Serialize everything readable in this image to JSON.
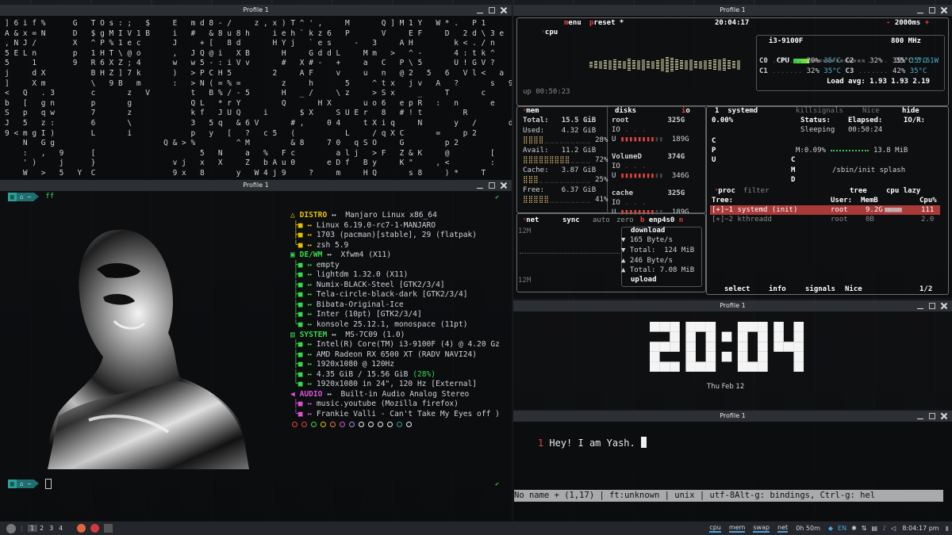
{
  "window_titles": {
    "top_left": "Profile 1",
    "mid_left": "Profile 1",
    "top_right": "Profile 1",
    "clock_pane": "Profile 1",
    "bottom_right": "Profile 1"
  },
  "matrix_lines": [
    "] 6 i f %      G   T O s : ;   $     E   m d 8 - /     z , x ) T ^ ' ,     M       Q ] M 1 Y   W * .   P 1",
    "A & x = N      D   $ g M I V 1 B     i   #   & 8 u 8 h     i e h ` k z 6   P       V     E F     D   2 d \\ 3 e",
    ", N J /        X   ^ P % 1 e c       J     + [   8 d       H Y j   ` e s     -   3     A H         k < . / n",
    "5 E L n        p   1 H T \\ @ o       ,   J Q @ i   X B       H     G d d L     M m   >   ^ -       4 : t k ^",
    "5     1        9   R 6 X Z ; 4       w   w 5 - : i V v       #   X # -   +     a   C   P \\ 5       U ! G V ?",
    "j     d X          B H Z ] 7 k       )   > P C H 5         2     A F     v     u   n   @ 2   5   6   V l <   a",
    "]     X m          \\   9 B   m       :   > N ( = % =         z     h       5     ^ t x   j v   A   ?       s   9",
    "<   Q   . 3        c       z   V         t   B % / - 5       H   _ /     \\ z     > S x     _     T       c",
    "b   [   g n        p       g             Q L   * r Y         Q       H X       u o 6   e p R   :   n       e",
    "S   p   q w        7       z             k f   J U Q     i       $ X     S U E r   8   # ! t         R",
    "J   5   z :        6       \\             3   5 q   & 6 V       # ,     0 4     t X i q     N       y   /       d",
    "9 < m g I )        L       i             p   y   [   ?   c 5   (           L     / q X C       =     p 2",
    "    N   G g                        Q & > %         ^ M         & 8     7 0   q S O     G         p 2",
    "    :   ,   9      [                       5   N     a   %   F c         a l j   > F   Z & K     @         [",
    "    ' )     j      }                 v j   x   X     Z   b A u 0       e D f   B y     K \"     , <         :",
    "    W   >   5   Y  C                 9 x   8       y   W 4 j 9     ?     m     H Q       s 8     ) *     T       I"
  ],
  "prompt": {
    "dir": "~",
    "cmd": "ff"
  },
  "fastfetch": [
    {
      "icon": "△",
      "label": "DISTRO",
      "val": "Manjaro Linux x86_64",
      "type": "head",
      "color": "#e5c100"
    },
    {
      "icon": "",
      "label": "",
      "val": "Linux 6.19.0-rc7-1-MANJARO",
      "type": "item",
      "color": "#e5c100"
    },
    {
      "icon": "",
      "label": "",
      "val": "1703 (pacman)[stable], 29 (flatpak)",
      "type": "item",
      "color": "#e5c100"
    },
    {
      "icon": "",
      "label": "",
      "val": "zsh 5.9",
      "type": "last",
      "color": "#e5c100"
    },
    {
      "icon": "▣",
      "label": "DE/WM",
      "val": "Xfwm4 (X11)",
      "type": "head",
      "color": "#38d94a"
    },
    {
      "icon": "",
      "label": "",
      "val": "empty",
      "type": "item",
      "color": "#38d94a"
    },
    {
      "icon": "",
      "label": "",
      "val": "lightdm 1.32.0 (X11)",
      "type": "item",
      "color": "#38d94a"
    },
    {
      "icon": "",
      "label": "",
      "val": "Numix-BLACK-Steel [GTK2/3/4]",
      "type": "item",
      "color": "#38d94a"
    },
    {
      "icon": "",
      "label": "",
      "val": "Tela-circle-black-dark [GTK2/3/4]",
      "type": "item",
      "color": "#38d94a"
    },
    {
      "icon": "",
      "label": "",
      "val": "Bibata-Original-Ice",
      "type": "item",
      "color": "#38d94a"
    },
    {
      "icon": "",
      "label": "",
      "val": "Inter (10pt) [GTK2/3/4]",
      "type": "item",
      "color": "#38d94a"
    },
    {
      "icon": "",
      "label": "",
      "val": "konsole 25.12.1, monospace (11pt)",
      "type": "last",
      "color": "#38d94a"
    },
    {
      "icon": "▤",
      "label": "SYSTEM",
      "val": "MS-7C09 (1.0)",
      "type": "head",
      "color": "#38d94a"
    },
    {
      "icon": "",
      "label": "",
      "val": "Intel(R) Core(TM) i3-9100F (4) @ 4.20 Gz",
      "type": "item",
      "color": "#38d94a"
    },
    {
      "icon": "",
      "label": "",
      "val": "AMD Radeon RX 6500 XT (RADV NAVI24)",
      "type": "item",
      "color": "#38d94a"
    },
    {
      "icon": "",
      "label": "",
      "val": "1920x1080 @ 120Hz",
      "type": "item",
      "color": "#38d94a"
    },
    {
      "icon": "",
      "label": "",
      "val": "4.35 GiB / 15.56 GiB (28%)",
      "type": "item",
      "color": "#38d94a"
    },
    {
      "icon": "",
      "label": "",
      "val": "1920x1080 in 24\", 120 Hz [External]",
      "type": "last",
      "color": "#38d94a"
    },
    {
      "icon": "◀",
      "label": "AUDIO",
      "val": "Built-in Audio Analog Stereo",
      "type": "head",
      "color": "#d455d4"
    },
    {
      "icon": "",
      "label": "",
      "val": "music.youtube (Mozilla firefox)",
      "type": "item",
      "color": "#d455d4"
    },
    {
      "icon": "",
      "label": "",
      "val": "Frankie Valli - Can't Take My Eyes off )",
      "type": "last",
      "color": "#d455d4"
    }
  ],
  "color_dots": [
    "#e0453f",
    "#e0453f",
    "#38d94a",
    "#e5c100",
    "#e0823f",
    "#d455d4",
    "#a98de0",
    "#f0f0f0",
    "#f0f0f0",
    "#f0f0f0",
    "#f0f0f0",
    "#2aa198",
    "#f0f0f0"
  ],
  "btop": {
    "cpu_tab": "cpu",
    "menu_tab": "menu",
    "preset_tab": "preset *",
    "clock": "20:04:17",
    "interval": "2000ms",
    "cpu_model": "i3-9100F",
    "cpu_freq": "800 MHz",
    "cpu_total_label": "CPU",
    "cpu_total_pct": "32%",
    "cpu_temp": "35°C",
    "cpu_power": "5.61W",
    "cores": [
      {
        "name": "C0",
        "pct": "29%",
        "temp": "35°C",
        "name2": "C2",
        "pct2": "35%",
        "temp2": "35°C"
      },
      {
        "name": "C1",
        "pct": "32%",
        "temp": "35°C",
        "name2": "C3",
        "pct2": "42%",
        "temp2": "35°C"
      }
    ],
    "load_avg": "Load avg: 1.93 1.93 2.19",
    "uptime": "up 00:50:23",
    "mem": {
      "title": "mem",
      "total_label": "Total:",
      "total": "15.5 GiB",
      "used_label": "Used:",
      "used": "4.32 GiB",
      "used_pct": "28%",
      "avail_label": "Avail:",
      "avail": "11.2 GiB",
      "avail_pct": "72%",
      "cache_label": "Cache:",
      "cache": "3.87 GiB",
      "cache_pct": "25%",
      "free_label": "Free:",
      "free": "6.37 GiB",
      "free_pct": "41%"
    },
    "disks": {
      "title": "disks",
      "io_label": "io",
      "items": [
        {
          "name": "root",
          "size": "325G",
          "io": "IO",
          "free": "189G"
        },
        {
          "name": "VolumeD",
          "size": "374G",
          "io": "IO",
          "free": "346G"
        },
        {
          "name": "cache",
          "size": "325G",
          "io": "IO",
          "free": "189G"
        }
      ]
    },
    "net": {
      "title": "net",
      "sync": "sync",
      "auto": "auto",
      "zero": "zero",
      "iface": "enp4s0",
      "scale_top": "12M",
      "scale_bottom": "12M",
      "download": "download",
      "dl_rate": "▼ 165 Byte/s",
      "dl_total": "▼ Total:  124 MiB",
      "ul_rate": "▲ 246 Byte/s",
      "ul_total": "▲ Total: 7.08 MiB",
      "upload": "upload"
    },
    "proc": {
      "pid": "1",
      "name": "systemd",
      "cpu": "0.00%",
      "status_label": "Status:",
      "status": "Sleeping",
      "elapsed_label": "Elapsed:",
      "elapsed": "00:50:24",
      "kill": "kill",
      "signals": "signals",
      "nice": "Nice",
      "hide": "hide",
      "io_label": "IO/R:",
      "mem_label": "M:0.09%",
      "mem_val": "13.8 MiB",
      "cmd": "/sbin/init splash",
      "letters": [
        "C",
        "P",
        "U",
        "C",
        "M",
        "D"
      ],
      "proc_tab": "proc",
      "filter": "filter",
      "tree_tab": "tree",
      "cpu_lazy": "cpu lazy",
      "cols": {
        "tree": "Tree:",
        "user": "User:",
        "mem": "MemB",
        "cpu": "Cpu%"
      },
      "rows": [
        {
          "tree": "[+]−1 systemd (init)",
          "user": "root",
          "mem": "9.2G",
          "cpu": "111",
          "selected": true
        },
        {
          "tree": "[+]−2 kthreadd",
          "user": "root",
          "mem": "0B",
          "cpu": "2.0",
          "selected": false
        }
      ],
      "footer_select": "select",
      "footer_info": "info",
      "footer_signals": "signals",
      "footer_nice": "Nice",
      "footer_page": "1/2"
    }
  },
  "clock_pane": {
    "time": "20:04",
    "date": "Thu Feb 12"
  },
  "editor": {
    "line_no": "1",
    "text": "Hey! I am Yash.",
    "status": "No name + (1,17) | ft:unknown | unix | utf-8Alt-g: bindings, Ctrl-g: hel"
  },
  "taskbar": {
    "workspaces": [
      "1",
      "2",
      "3",
      "4"
    ],
    "labels": [
      "cpu",
      "mem",
      "swap",
      "net"
    ],
    "uptime": "0h 50m",
    "lang": "EN",
    "clock": "8:04:17 pm"
  }
}
